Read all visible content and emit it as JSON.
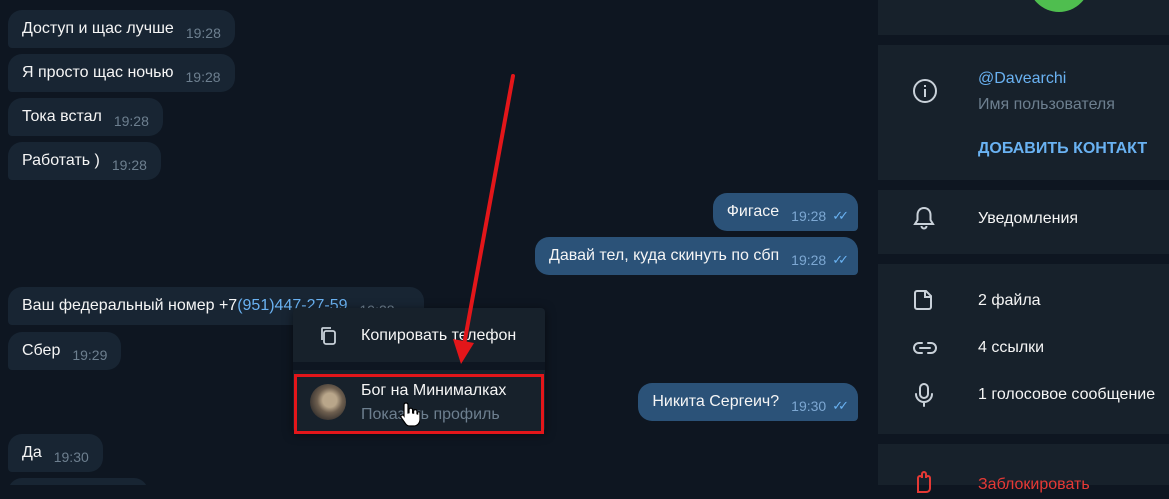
{
  "messages": [
    {
      "text": "Доступ и щас лучше",
      "time": "19:28",
      "dir": "in"
    },
    {
      "text": "Я просто щас ночью",
      "time": "19:28",
      "dir": "in"
    },
    {
      "text": "Тока встал",
      "time": "19:28",
      "dir": "in"
    },
    {
      "text": "Работать )",
      "time": "19:28",
      "dir": "in"
    },
    {
      "text": "Фигасе",
      "time": "19:28",
      "dir": "out"
    },
    {
      "text": "Давай тел, куда скинуть по сбп",
      "time": "19:28",
      "dir": "out"
    },
    {
      "text": "Ваш федеральный номер +7 ",
      "phone": "(951)447-27-59",
      "time": "19:28",
      "dir": "in"
    },
    {
      "text": "Сбер",
      "time": "19:29",
      "dir": "in"
    },
    {
      "text": "Никита Сергеич?",
      "time": "19:30",
      "dir": "out"
    },
    {
      "text": "Да",
      "time": "19:30",
      "dir": "in"
    }
  ],
  "context_menu": {
    "copy_label": "Копировать телефон",
    "profile_name": "Бог на Минималках",
    "profile_sub": "Показать профиль"
  },
  "panel": {
    "username": "@Davearchi",
    "username_caption": "Имя пользователя",
    "add_contact": "ДОБАВИТЬ КОНТАКТ",
    "notifications": "Уведомления",
    "files": "2 файла",
    "links": "4 ссылки",
    "voice": "1 голосовое сообщение",
    "block": "Заблокировать"
  },
  "colors": {
    "background": "#0e1621",
    "incoming_bubble": "#182533",
    "outgoing_bubble": "#2b5278",
    "panel": "#17212b",
    "accent": "#6ab2f2",
    "annotation_red": "#e3161a",
    "danger": "#e53935"
  },
  "icons": [
    "copy-icon",
    "info-icon",
    "bell-icon",
    "file-icon",
    "link-icon",
    "mic-icon",
    "hand-icon",
    "double-check-icon"
  ]
}
